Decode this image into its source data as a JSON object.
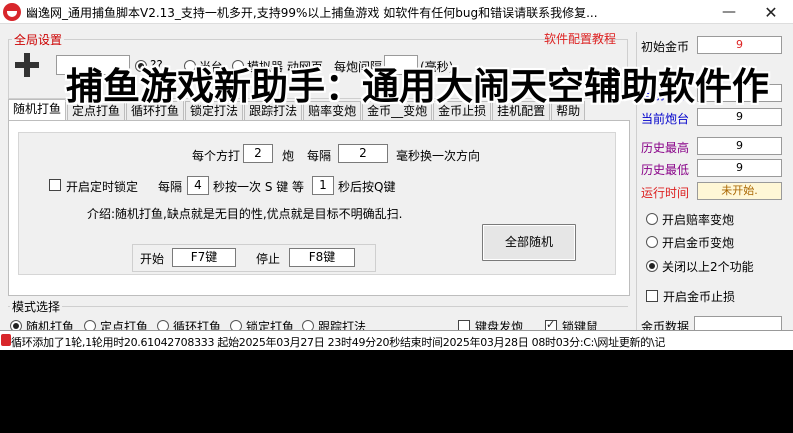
{
  "window": {
    "title": "幽逸网_通用捕鱼脚本V2.13_支持一机多开,支持99%以上捕鱼游戏  如软件有任何bug和错误请联系我修复...",
    "min_glyph": "—",
    "close_glyph": "✕"
  },
  "global": {
    "label": "全局设置",
    "radio1_label": "??",
    "radio2_label": "当台",
    "radio3_label": "模拟器 动网页",
    "interval_label": "每炮间隔",
    "interval_unit": "(毫秒)",
    "config_link": "软件配置教程"
  },
  "banner": "捕鱼游戏新助手：通用大闹天空辅助软件作",
  "tabs": [
    "随机打鱼",
    "定点打鱼",
    "循环打鱼",
    "锁定打法",
    "跟踪打法",
    "赔率变炮",
    "金币__变炮",
    "金币止损",
    "挂机配置",
    "帮助"
  ],
  "random_panel": {
    "per_prefix": "每个方打",
    "per_value": "2",
    "per_unit": "炮",
    "every_label": "每隔",
    "every_value": "2",
    "every_unit": "毫秒换一次方向",
    "timer_lock_label": "开启定时锁定",
    "timer_every": "每隔",
    "timer_value": "4",
    "timer_text1": "秒按一次 S 键 等",
    "timer_wait": "1",
    "timer_text2": "秒后按Q键",
    "intro": "介绍:随机打鱼,缺点就是无目的性,优点就是目标不明确乱扫.",
    "start_label": "开始",
    "start_key": "F7键",
    "stop_label": "停止",
    "stop_key": "F8键",
    "all_random_button": "全部随机"
  },
  "mode": {
    "label": "模式选择",
    "options": [
      "随机打鱼",
      "定点打鱼",
      "循环打鱼",
      "锁定打鱼",
      "跟踪打法"
    ],
    "selected_index": 0,
    "kbd_fire": "键盘发炮",
    "lock_key": "锁键鼠"
  },
  "stats": {
    "initial_gold_label": "初始金币",
    "initial_gold_value": "9",
    "current_gold_label": "当前金币",
    "current_gold_value": "9",
    "current_cannon_label": "当前炮台",
    "current_cannon_value": "9",
    "hist_high_label": "历史最高",
    "hist_high_value": "9",
    "hist_low_label": "历史最低",
    "hist_low_value": "9",
    "runtime_label": "运行时间",
    "runtime_value": "未开始."
  },
  "options": {
    "odds_change": "开启赔率变炮",
    "gold_change": "开启金币变炮",
    "close_above": "关闭以上2个功能",
    "selected_index": 2,
    "gold_stoploss": "开启金币止损",
    "gold_data_label": "金币数据"
  },
  "status": {
    "text": "循环添加了1轮,1轮用时20.61042708333   起始2025年03月27日 23时49分20秒结束时间2025年03月28日 08时03分:C:\\网址更新的\\记"
  },
  "colors": {
    "accent_red": "#d22",
    "accent_blue": "#00c"
  }
}
